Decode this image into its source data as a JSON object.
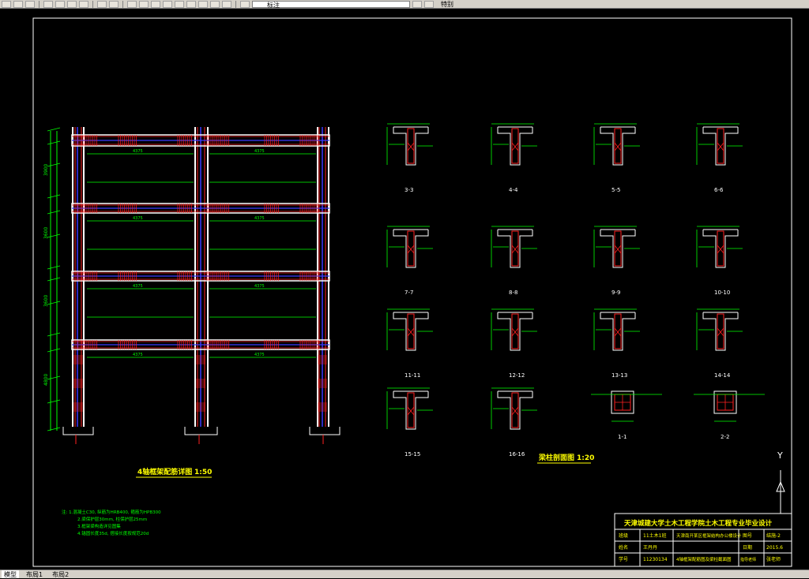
{
  "toolbar": {
    "layer_name": "标注",
    "right_label": "特别"
  },
  "tabs": [
    "模型",
    "布局1",
    "布局2"
  ],
  "drawing": {
    "frame_title": "4轴框架配筋详图",
    "frame_scale": "1:50",
    "beam_title": "梁柱剖面图",
    "beam_scale": "1:20",
    "notes": [
      "注: 1.混凝土C30, 纵筋为HRB400, 箍筋为HPB300",
      "2.梁保护层30mm, 柱保护层25mm",
      "3.框架梁构造详见图集",
      "4.锚固长度35d, 搭接长度按规范20d"
    ],
    "floor_dims": [
      "3900",
      "3600",
      "3600",
      "4800"
    ],
    "span_dims": [
      "4375",
      "4375"
    ],
    "section_labels": [
      "3-3",
      "4-4",
      "5-5",
      "6-6",
      "7-7",
      "8-8",
      "9-9",
      "10-10",
      "11-11",
      "12-12",
      "13-13",
      "14-14",
      "15-15",
      "16-16",
      "1-1",
      "2-2"
    ],
    "title_block": {
      "school": "天津城建大学土木工程学院土木工程专业毕业设计",
      "row1": [
        "班级",
        "11土木1班",
        "天津南开某区框架结构办公楼设计",
        "图号",
        "结施-2"
      ],
      "row2": [
        "姓名",
        "王丹丹",
        "",
        "日期",
        "2015.6"
      ],
      "row3": [
        "学号",
        "11230134",
        "4轴框架配筋图及梁柱截面图",
        "指导老师",
        "张老师"
      ]
    },
    "axis_label": "Y"
  }
}
